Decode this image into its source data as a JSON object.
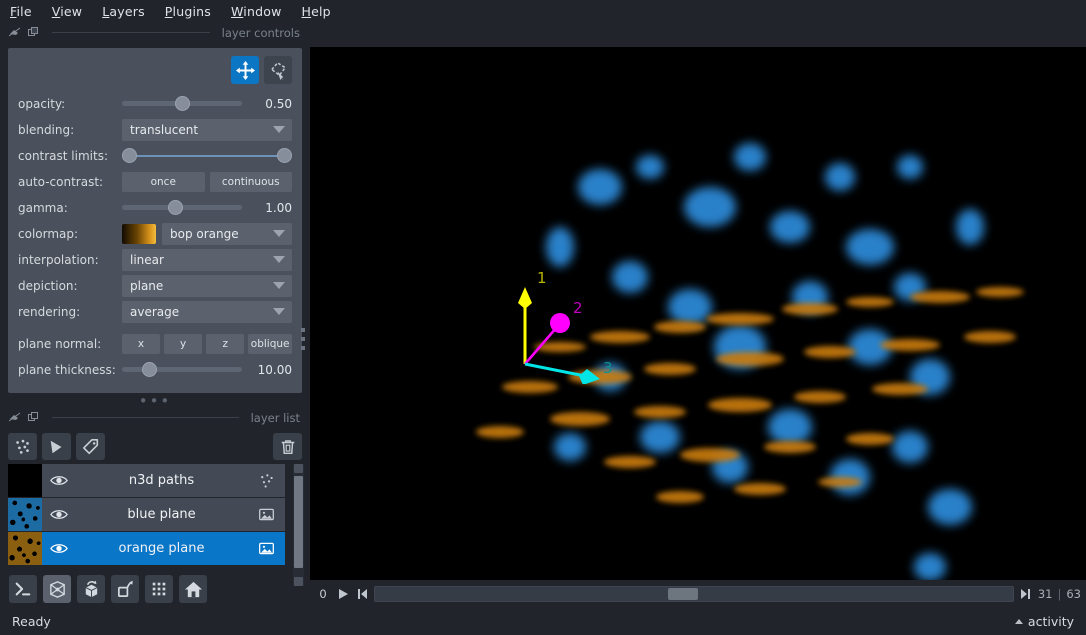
{
  "menubar": {
    "items": [
      {
        "label": "File",
        "mnemonic": "F"
      },
      {
        "label": "View",
        "mnemonic": "V"
      },
      {
        "label": "Layers",
        "mnemonic": "L"
      },
      {
        "label": "Plugins",
        "mnemonic": "P"
      },
      {
        "label": "Window",
        "mnemonic": "W"
      },
      {
        "label": "Help",
        "mnemonic": "H"
      }
    ]
  },
  "layer_controls": {
    "dock_title": "layer controls",
    "mode_buttons": [
      {
        "name": "pan-zoom",
        "icon": "move-icon",
        "active": true
      },
      {
        "name": "transform",
        "icon": "transform-icon",
        "active": false
      }
    ],
    "opacity": {
      "label": "opacity:",
      "value": "0.50",
      "fraction": 0.5
    },
    "blending": {
      "label": "blending:",
      "value": "translucent"
    },
    "contrast_limits": {
      "label": "contrast limits:",
      "low": 0.0,
      "high": 1.0
    },
    "auto_contrast": {
      "label": "auto-contrast:",
      "once": "once",
      "continuous": "continuous"
    },
    "gamma": {
      "label": "gamma:",
      "value": "1.00",
      "fraction": 0.38
    },
    "colormap": {
      "label": "colormap:",
      "value": "bop orange",
      "swatch_start": "#140d03",
      "swatch_end": "#f0a81e"
    },
    "interpolation": {
      "label": "interpolation:",
      "value": "linear"
    },
    "depiction": {
      "label": "depiction:",
      "value": "plane"
    },
    "rendering": {
      "label": "rendering:",
      "value": "average"
    },
    "plane_normal": {
      "label": "plane normal:",
      "options": [
        "x",
        "y",
        "z",
        "oblique"
      ]
    },
    "plane_thickness": {
      "label": "plane thickness:",
      "value": "10.00",
      "fraction": 0.17
    }
  },
  "layer_list": {
    "dock_title": "layer list",
    "tools": [
      {
        "name": "new-points-layer",
        "icon": "points-icon"
      },
      {
        "name": "new-shapes-layer",
        "icon": "shapes-icon"
      },
      {
        "name": "new-labels-layer",
        "icon": "labels-icon"
      },
      {
        "name": "delete-layer",
        "icon": "trash-icon"
      }
    ],
    "layers": [
      {
        "name": "n3d paths",
        "selected": false,
        "visible": true,
        "type_icon": "points-icon",
        "thumb": "black"
      },
      {
        "name": "blue plane",
        "selected": false,
        "visible": true,
        "type_icon": "image-icon",
        "thumb": "blue"
      },
      {
        "name": "orange plane",
        "selected": true,
        "visible": true,
        "type_icon": "image-icon",
        "thumb": "orange"
      }
    ]
  },
  "viewer_buttons": [
    {
      "name": "console-button",
      "icon": "console-icon",
      "active": false
    },
    {
      "name": "ndisplay-button",
      "icon": "cube-2d3d-icon",
      "active": true
    },
    {
      "name": "roll-dims-button",
      "icon": "roll-cube-icon",
      "active": false
    },
    {
      "name": "transpose-dims-button",
      "icon": "transpose-icon",
      "active": false
    },
    {
      "name": "grid-view-button",
      "icon": "grid-icon",
      "active": false
    },
    {
      "name": "reset-view-button",
      "icon": "home-icon",
      "active": false
    }
  ],
  "dims_slider": {
    "axis_label": "0",
    "play_icon": "play-icon",
    "first_icon": "step-first-icon",
    "last_icon": "step-last-icon",
    "current": "31",
    "separator": "|",
    "max": "63",
    "fraction": 0.46
  },
  "statusbar": {
    "status": "Ready",
    "activity": "activity",
    "activity_icon": "chevron-up-icon"
  },
  "canvas": {
    "axes": [
      {
        "label": "1",
        "color": "#ffff00",
        "name": "axis-1-yellow"
      },
      {
        "label": "2",
        "color": "#ff00ff",
        "name": "axis-2-magenta"
      },
      {
        "label": "3",
        "color": "#00e5e5",
        "name": "axis-3-cyan"
      }
    ],
    "background": "#000000"
  }
}
